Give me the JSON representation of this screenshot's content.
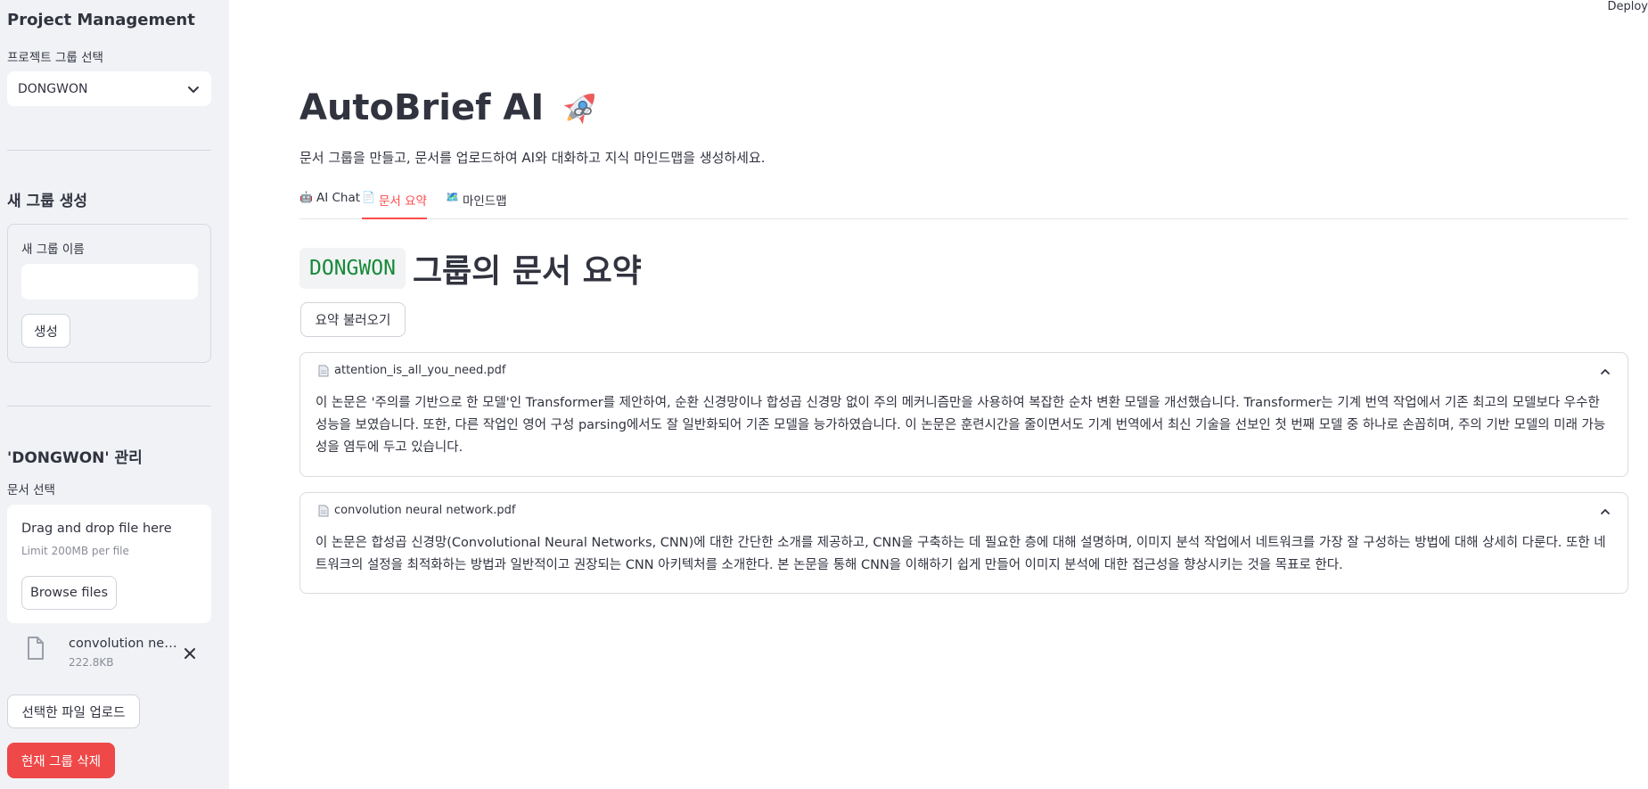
{
  "sidebar": {
    "title": "Project Management",
    "group_select_label": "프로젝트 그룹 선택",
    "group_select_value": "DONGWON",
    "new_group_heading": "새 그룹 생성",
    "new_group_name_label": "새 그룹 이름",
    "new_group_name_value": "",
    "create_button": "생성",
    "manage_heading": "'DONGWON' 관리",
    "doc_select_label": "문서 선택",
    "uploader": {
      "title": "Drag and drop file here",
      "limit": "Limit 200MB per file",
      "browse_button": "Browse files"
    },
    "uploaded_file": {
      "name": "convolution neural network.pdf",
      "size": "222.8KB"
    },
    "upload_selected_button": "선택한 파일 업로드",
    "delete_group_button": "현재 그룹 삭제"
  },
  "header": {
    "deploy": "Deploy"
  },
  "main": {
    "title": "AutoBrief AI",
    "subtitle": "문서 그룹을 만들고, 문서를 업로드하여 AI와 대화하고 지식 마인드맵을 생성하세요.",
    "tabs": [
      {
        "icon": "🤖",
        "label": "AI Chat",
        "active": false
      },
      {
        "icon": "📄",
        "label": "문서 요약",
        "active": true
      },
      {
        "icon": "🗺️",
        "label": "마인드맵",
        "active": false
      }
    ],
    "summary_heading_group": "DONGWON",
    "summary_heading_text": "그룹의 문서 요약",
    "load_summary_button": "요약 불러오기",
    "summaries": [
      {
        "filename": "attention_is_all_you_need.pdf",
        "text": "이 논문은 '주의를 기반으로 한 모델'인 Transformer를 제안하여, 순환 신경망이나 합성곱 신경망 없이 주의 메커니즘만을 사용하여 복잡한 순차 변환 모델을 개선했습니다. Transformer는 기계 번역 작업에서 기존 최고의 모델보다 우수한 성능을 보였습니다. 또한, 다른 작업인 영어 구성 parsing에서도 잘 일반화되어 기존 모델을 능가하였습니다. 이 논문은 훈련시간을 줄이면서도 기계 번역에서 최신 기술을 선보인 첫 번째 모델 중 하나로 손꼽히며, 주의 기반 모델의 미래 가능성을 염두에 두고 있습니다."
      },
      {
        "filename": "convolution neural network.pdf",
        "text": "이 논문은 합성곱 신경망(Convolutional Neural Networks, CNN)에 대한 간단한 소개를 제공하고, CNN을 구축하는 데 필요한 층에 대해 설명하며, 이미지 분석 작업에서 네트워크를 가장 잘 구성하는 방법에 대해 상세히 다룬다. 또한 네트워크의 설정을 최적화하는 방법과 일반적이고 권장되는 CNN 아키텍처를 소개한다. 본 논문을 통해 CNN을 이해하기 쉽게 만들어 이미지 분석에 대한 접근성을 향상시키는 것을 목표로 한다."
      }
    ]
  },
  "colors": {
    "primary": "#ff4b4b",
    "danger_button": "#ee4848",
    "sidebar_bg": "#f0f2f6",
    "code_text": "#178a3a"
  },
  "icons": [
    "chevron-down-icon",
    "rocket-icon",
    "link-icon",
    "file-icon",
    "close-icon",
    "document-icon",
    "chevron-up-icon"
  ]
}
